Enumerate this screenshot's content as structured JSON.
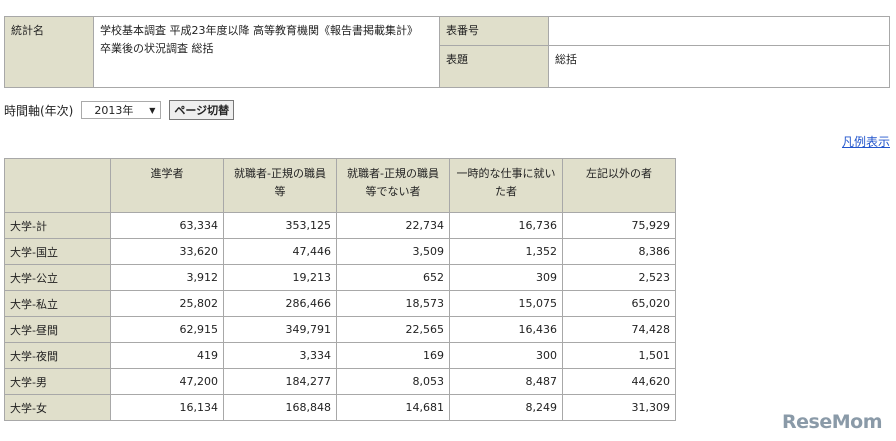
{
  "info": {
    "stat_label": "統計名",
    "stat_value_line1": "学校基本調査 平成23年度以降 高等教育機関《報告書掲載集計》",
    "stat_value_line2": "卒業後の状況調査 総括",
    "table_no_label": "表番号",
    "table_no_value": "",
    "title_label": "表題",
    "title_value": "総括"
  },
  "time": {
    "label": "時間軸(年次)",
    "selected": "2013年",
    "button": "ページ切替"
  },
  "legend_link": "凡例表示",
  "table": {
    "headers": [
      "進学者",
      "就職者-正規の職員等",
      "就職者-正規の職員等でない者",
      "一時的な仕事に就いた者",
      "左記以外の者"
    ],
    "rows": [
      {
        "label": "大学-計",
        "values": [
          "63,334",
          "353,125",
          "22,734",
          "16,736",
          "75,929"
        ]
      },
      {
        "label": "大学-国立",
        "values": [
          "33,620",
          "47,446",
          "3,509",
          "1,352",
          "8,386"
        ]
      },
      {
        "label": "大学-公立",
        "values": [
          "3,912",
          "19,213",
          "652",
          "309",
          "2,523"
        ]
      },
      {
        "label": "大学-私立",
        "values": [
          "25,802",
          "286,466",
          "18,573",
          "15,075",
          "65,020"
        ]
      },
      {
        "label": "大学-昼間",
        "values": [
          "62,915",
          "349,791",
          "22,565",
          "16,436",
          "74,428"
        ]
      },
      {
        "label": "大学-夜間",
        "values": [
          "419",
          "3,334",
          "169",
          "300",
          "1,501"
        ]
      },
      {
        "label": "大学-男",
        "values": [
          "47,200",
          "184,277",
          "8,053",
          "8,487",
          "44,620"
        ]
      },
      {
        "label": "大学-女",
        "values": [
          "16,134",
          "168,848",
          "14,681",
          "8,249",
          "31,309"
        ]
      }
    ]
  },
  "watermark": "ReseMom"
}
